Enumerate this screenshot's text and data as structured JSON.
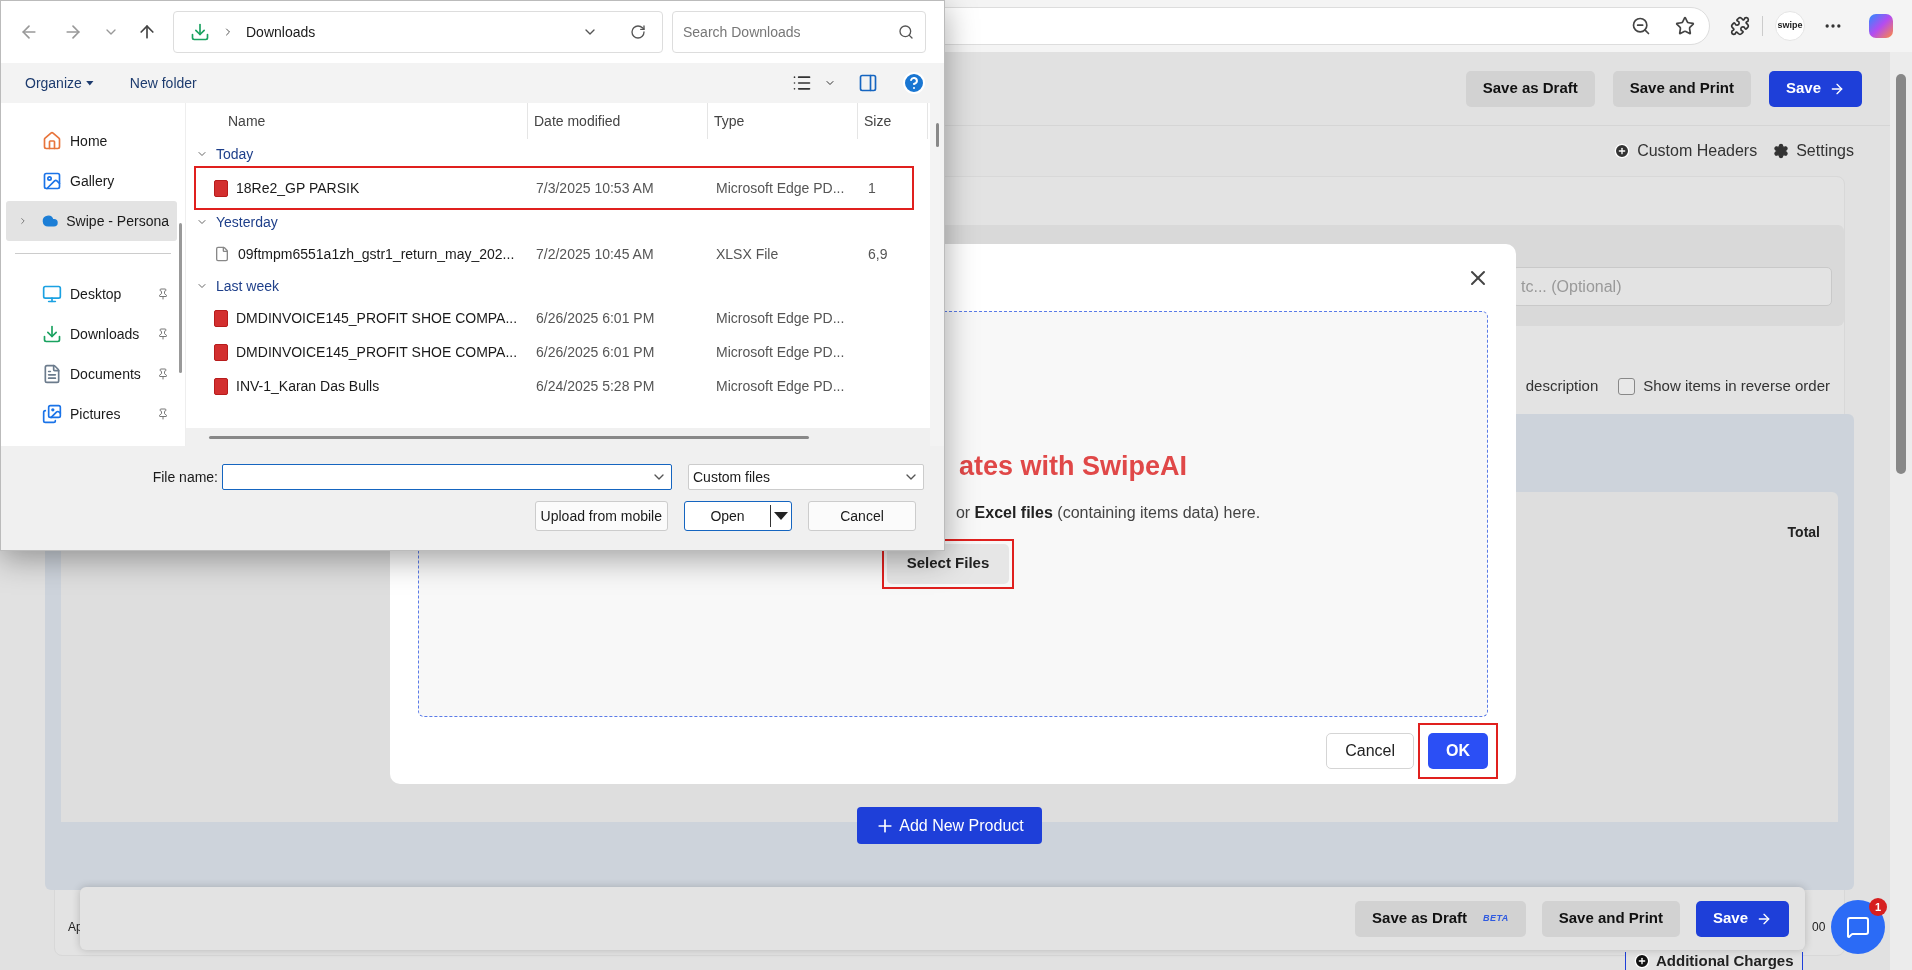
{
  "browser": {
    "profile_label": "swipe"
  },
  "page": {
    "top_actions": [
      {
        "label": "Save as Draft",
        "kind": "secondary"
      },
      {
        "label": "Save and Print",
        "kind": "secondary"
      },
      {
        "label": "Save",
        "kind": "primary"
      }
    ],
    "links": [
      {
        "label": "Custom Headers",
        "kind": "headers"
      },
      {
        "label": "Settings",
        "kind": "settings"
      }
    ],
    "notes_placeholder": "tc... (Optional)",
    "description_label": "description",
    "options": [
      {
        "label": "Show items in reverse order",
        "checked": false
      }
    ],
    "table_total_header": "Total",
    "add_product": "Add New Product",
    "bottom_left_text": "Ap",
    "bottom_right_text": "00",
    "bottom_actions": [
      {
        "label": "Save as Draft",
        "badge": "BETA",
        "kind": "secondary"
      },
      {
        "label": "Save and Print",
        "kind": "secondary"
      },
      {
        "label": "Save",
        "kind": "primary"
      }
    ],
    "additional_charges": "Additional Charges",
    "chat_badge": "1"
  },
  "modal": {
    "title": "ates with SwipeAI",
    "description": "or **Excel files** (containing items data) here.",
    "select_button": {
      "label": "Select Files",
      "highlighted": true
    },
    "buttons": [
      {
        "label": "Cancel",
        "kind": "secondary",
        "highlighted": false
      },
      {
        "label": "OK",
        "kind": "primary",
        "highlighted": true
      }
    ]
  },
  "file_dialog": {
    "location": "Downloads",
    "search_placeholder": "Search Downloads",
    "commands": [
      "Organize",
      "New folder"
    ],
    "nav": [
      {
        "label": "Home",
        "kind": "home",
        "pinned": false,
        "selected": false
      },
      {
        "label": "Gallery",
        "kind": "gallery",
        "pinned": false,
        "selected": false
      },
      {
        "label": "Swipe - Persona",
        "kind": "cloud",
        "pinned": false,
        "selected": true
      },
      {
        "label": "Desktop",
        "kind": "desktop",
        "pinned": true,
        "selected": false
      },
      {
        "label": "Downloads",
        "kind": "downloads",
        "pinned": true,
        "selected": false
      },
      {
        "label": "Documents",
        "kind": "documents",
        "pinned": true,
        "selected": false
      },
      {
        "label": "Pictures",
        "kind": "pictures",
        "pinned": true,
        "selected": false
      }
    ],
    "columns": [
      "Name",
      "Date modified",
      "Type",
      "Size"
    ],
    "groups": [
      {
        "label": "Today",
        "files": [
          {
            "name": "18Re2_GP PARSIK",
            "date": "7/3/2025 10:53 AM",
            "type": "Microsoft Edge PD...",
            "size": "1",
            "kind": "pdf",
            "highlighted": true
          }
        ]
      },
      {
        "label": "Yesterday",
        "files": [
          {
            "name": "09ftmpm6551a1zh_gstr1_return_may_202...",
            "date": "7/2/2025 10:45 AM",
            "type": "XLSX File",
            "size": "6,9",
            "kind": "doc",
            "highlighted": false
          }
        ]
      },
      {
        "label": "Last week",
        "files": [
          {
            "name": "DMDINVOICE145_PROFIT SHOE COMPA...",
            "date": "6/26/2025 6:01 PM",
            "type": "Microsoft Edge PD...",
            "kind": "pdf",
            "highlighted": false
          },
          {
            "name": "DMDINVOICE145_PROFIT SHOE COMPA...",
            "date": "6/26/2025 6:01 PM",
            "type": "Microsoft Edge PD...",
            "kind": "pdf",
            "highlighted": false
          },
          {
            "name": "INV-1_Karan Das Bulls",
            "date": "6/24/2025 5:28 PM",
            "type": "Microsoft Edge PD...",
            "kind": "pdf",
            "highlighted": false
          }
        ]
      }
    ],
    "file_name_label": "File name:",
    "file_type": "Custom files",
    "buttons": [
      {
        "label": "Upload from mobile",
        "kind": "plain"
      },
      {
        "label": "Open",
        "kind": "split"
      },
      {
        "label": "Cancel",
        "kind": "plain"
      }
    ]
  }
}
